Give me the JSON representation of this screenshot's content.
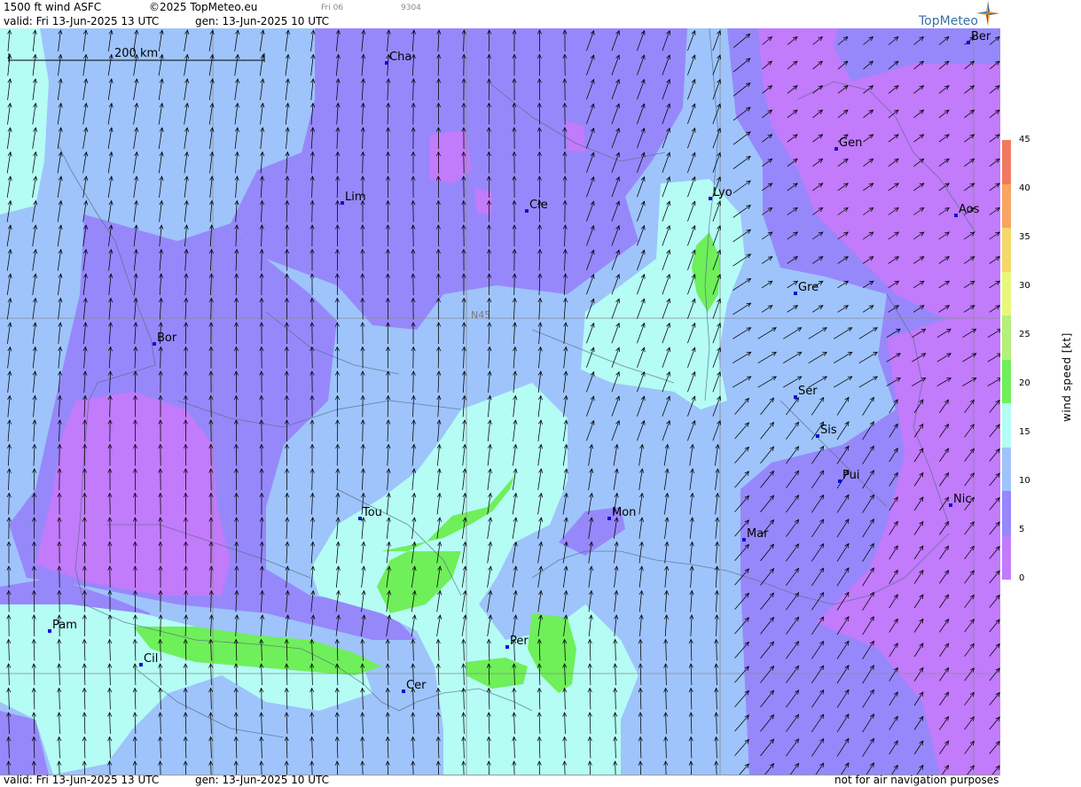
{
  "header": {
    "title": "1500 ft wind ASFC",
    "copyright": "©2025 TopMeteo.eu",
    "day_code": "Fri 06",
    "code": "9304",
    "valid": "valid:  Fri  13-Jun-2025  13 UTC",
    "gen": "gen: 13-Jun-2025 10 UTC"
  },
  "logo": {
    "text": "TopMeteo",
    "icon": "compass-star-icon"
  },
  "footer": {
    "valid": "valid:  Fri  13-Jun-2025  13 UTC",
    "gen": "gen: 13-Jun-2025 10 UTC",
    "disclaimer": "not for air navigation purposes"
  },
  "map": {
    "scale_label": "200 km",
    "gridline_label": "N45",
    "cities": [
      {
        "name": "Cha"
      },
      {
        "name": "Ber"
      },
      {
        "name": "Lim"
      },
      {
        "name": "Cle"
      },
      {
        "name": "Gen"
      },
      {
        "name": "Lyo"
      },
      {
        "name": "Aos"
      },
      {
        "name": "Gre"
      },
      {
        "name": "Bor"
      },
      {
        "name": "Ser"
      },
      {
        "name": "Sis"
      },
      {
        "name": "Pui"
      },
      {
        "name": "Tou"
      },
      {
        "name": "Mon"
      },
      {
        "name": "Mar"
      },
      {
        "name": "Nic"
      },
      {
        "name": "Pam"
      },
      {
        "name": "Per"
      },
      {
        "name": "Cil"
      },
      {
        "name": "Cer"
      }
    ]
  },
  "legend": {
    "title": "wind speed [kt]",
    "ticks": [
      "45",
      "40",
      "35",
      "30",
      "25",
      "20",
      "15",
      "10",
      "5",
      "0"
    ],
    "colors": [
      "#f07a60",
      "#f7a561",
      "#f5d86a",
      "#e9f77c",
      "#b4f07a",
      "#6fef5a",
      "#b5fcf5",
      "#9ec4fb",
      "#9688fa",
      "#c17bfb"
    ]
  },
  "palette": {
    "calm": "#c17bfb",
    "light": "#9688fa",
    "moderate": "#9ec4fb",
    "fresh": "#b5fcf5",
    "strong": "#6fef5a"
  }
}
